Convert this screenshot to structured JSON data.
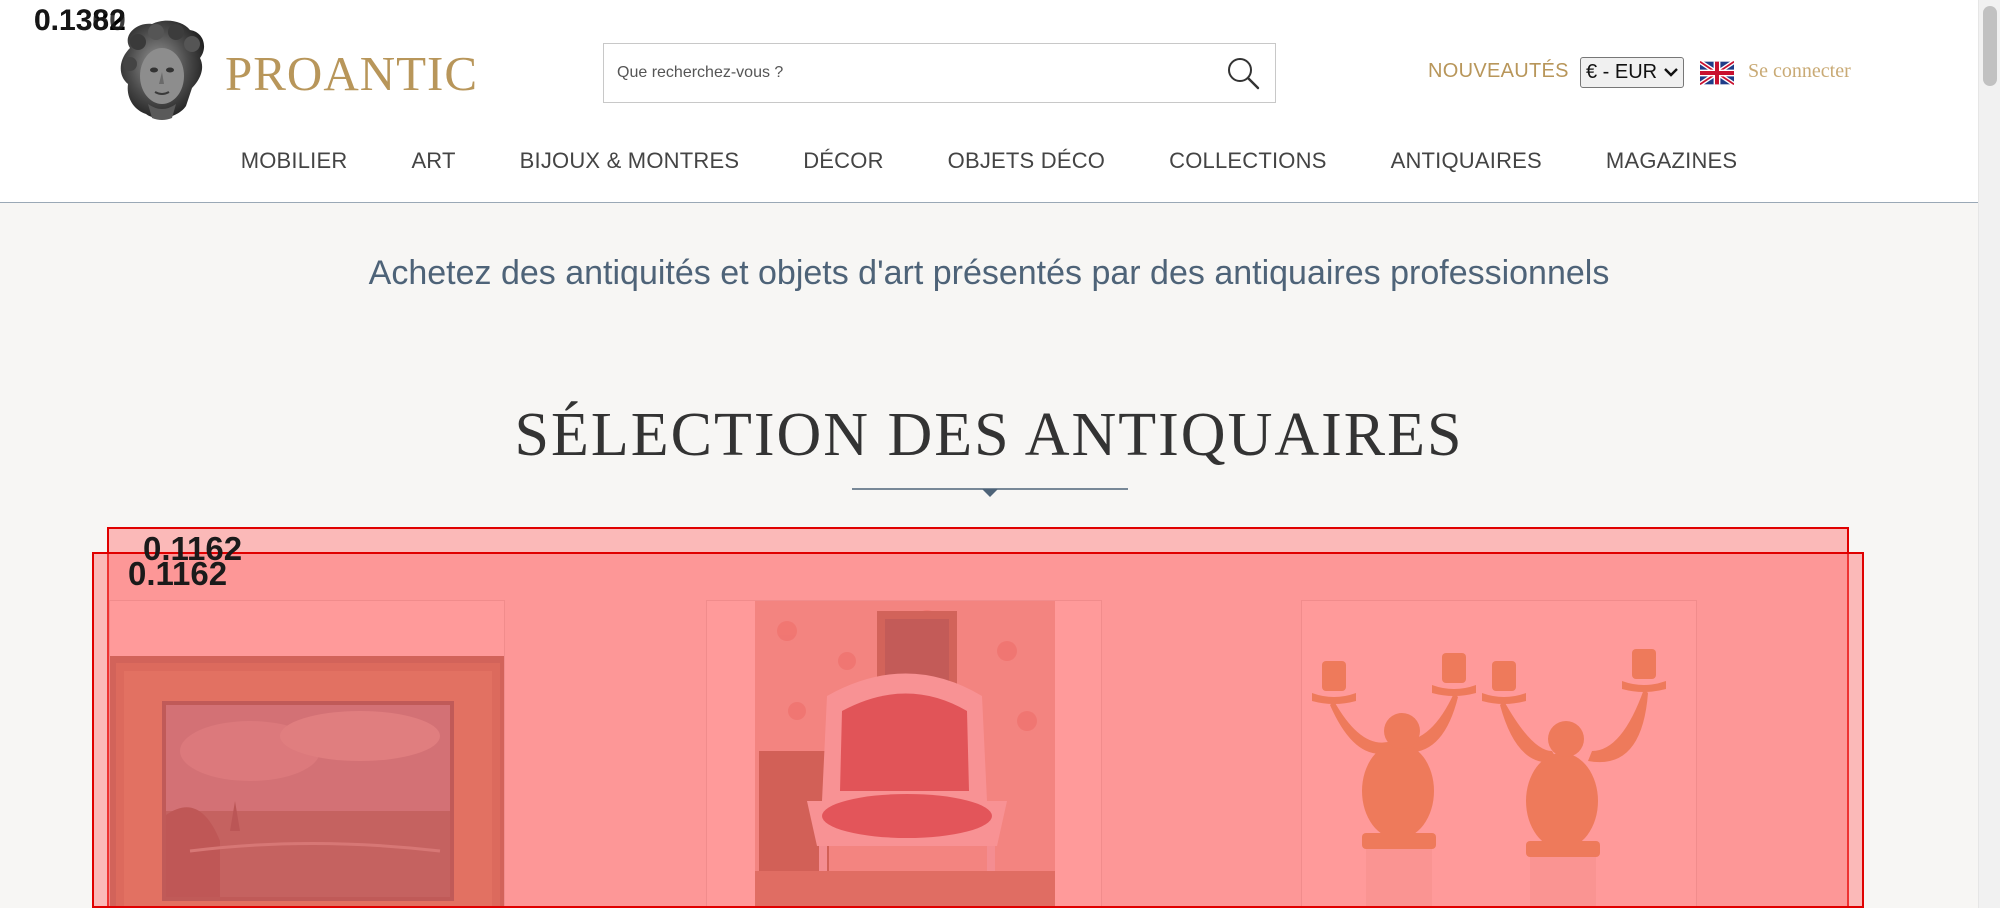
{
  "overlay": {
    "corner_scores": [
      "0.1382",
      "0.1360"
    ],
    "box_scores": [
      "0.1162",
      "0.1162"
    ]
  },
  "header": {
    "brand": "PROANTIC",
    "search_placeholder": "Que recherchez-vous ?",
    "nouveautes": "NOUVEAUTÉS",
    "currency": "€ - EUR",
    "login": "Se connecter"
  },
  "nav": {
    "items": [
      "MOBILIER",
      "ART",
      "BIJOUX & MONTRES",
      "DÉCOR",
      "OBJETS DÉCO",
      "COLLECTIONS",
      "ANTIQUAIRES",
      "MAGAZINES"
    ]
  },
  "main": {
    "tagline": "Achetez des antiquités et objets d'art présentés par des antiquaires professionnels",
    "section_title": "SÉLECTION DES ANTIQUAIRES"
  },
  "products": [
    {
      "icon": "framed-seascape-painting"
    },
    {
      "icon": "red-armchair-in-room"
    },
    {
      "icon": "gilt-bronze-candelabra-pair"
    }
  ],
  "colors": {
    "accent_gold": "#b8965a",
    "text_blue": "#4e6378",
    "page_bg": "#f7f6f4",
    "overlay_red": "#e00000"
  }
}
